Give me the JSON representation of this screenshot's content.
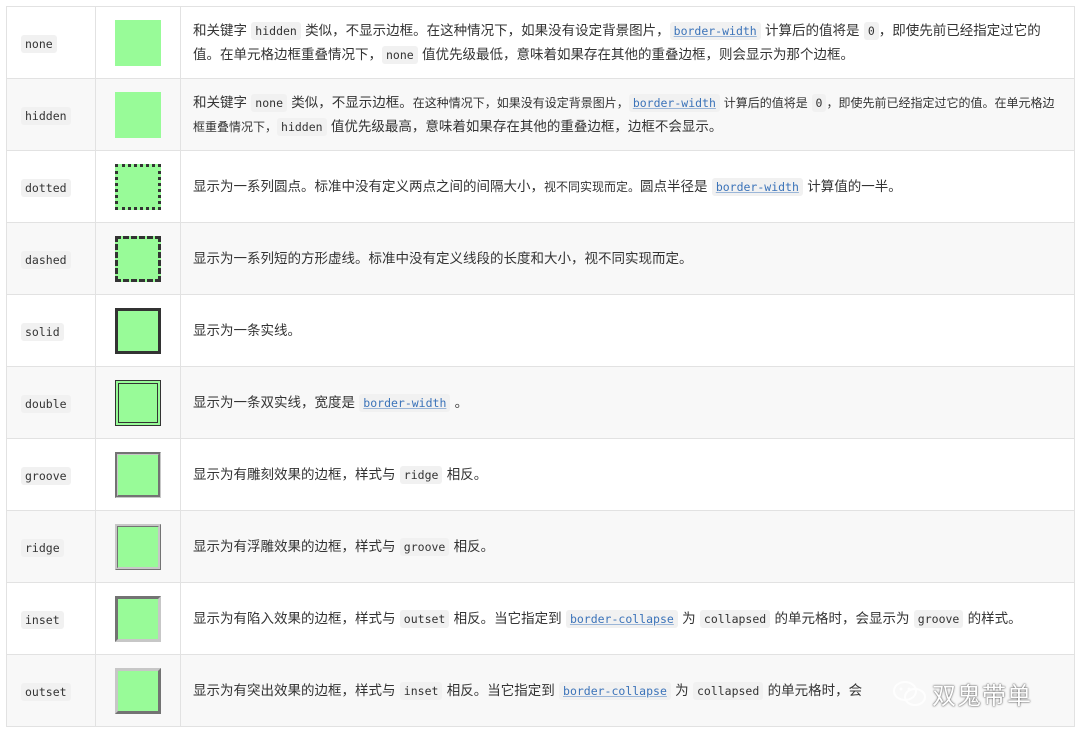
{
  "rows": [
    {
      "keyword": "none",
      "style": "none",
      "segments": [
        {
          "t": "text",
          "v": "和关键字 "
        },
        {
          "t": "code",
          "v": "hidden"
        },
        {
          "t": "text",
          "v": " 类似，不显示边框。在这种情况下，如果没有设定背景图片，"
        },
        {
          "t": "link",
          "v": "border-width"
        },
        {
          "t": "text",
          "v": " 计算后的值将是 "
        },
        {
          "t": "code",
          "v": "0"
        },
        {
          "t": "text",
          "v": "，即使先前已经指定过它的值。在单元格边框重叠情况下，"
        },
        {
          "t": "code",
          "v": "none"
        },
        {
          "t": "text",
          "v": " 值优先级最低，意味着如果存在其他的重叠边框，则会显示为那个边框。"
        }
      ]
    },
    {
      "keyword": "hidden",
      "style": "hidden",
      "segments": [
        {
          "t": "text",
          "v": "和关键字 "
        },
        {
          "t": "code",
          "v": "none"
        },
        {
          "t": "text",
          "v": " 类似，不显示边框。"
        },
        {
          "t": "small",
          "v": "在这种情况下，如果没有设定背景图片，"
        },
        {
          "t": "link",
          "v": "border-width"
        },
        {
          "t": "small",
          "v": " 计算后的值将是 "
        },
        {
          "t": "code",
          "v": "0"
        },
        {
          "t": "small",
          "v": "，即使先前已经指定过它的值。在单元格边框重叠情况下，"
        },
        {
          "t": "code",
          "v": "hidden"
        },
        {
          "t": "text",
          "v": " 值优先级最高，意味着如果存在其他的重叠边框，边框不会显示。"
        }
      ]
    },
    {
      "keyword": "dotted",
      "style": "dotted",
      "segments": [
        {
          "t": "text",
          "v": "显示为一系列圆点。标准中没有定义两点之间的间隔大小，"
        },
        {
          "t": "small",
          "v": "视不同实现而定。"
        },
        {
          "t": "text",
          "v": "圆点半径是 "
        },
        {
          "t": "link",
          "v": "border-width"
        },
        {
          "t": "text",
          "v": " 计算值的一半。"
        }
      ]
    },
    {
      "keyword": "dashed",
      "style": "dashed",
      "segments": [
        {
          "t": "text",
          "v": "显示为一系列短的方形虚线。标准中没有定义线段的长度和大小，视不同实现而定。"
        }
      ]
    },
    {
      "keyword": "solid",
      "style": "solid",
      "segments": [
        {
          "t": "text",
          "v": "显示为一条实线。"
        }
      ]
    },
    {
      "keyword": "double",
      "style": "double",
      "segments": [
        {
          "t": "text",
          "v": "显示为一条双实线，宽度是 "
        },
        {
          "t": "link",
          "v": "border-width"
        },
        {
          "t": "text",
          "v": " 。"
        }
      ]
    },
    {
      "keyword": "groove",
      "style": "groove",
      "segments": [
        {
          "t": "text",
          "v": "显示为有雕刻效果的边框，样式与 "
        },
        {
          "t": "code",
          "v": "ridge"
        },
        {
          "t": "text",
          "v": " 相反。"
        }
      ]
    },
    {
      "keyword": "ridge",
      "style": "ridge",
      "segments": [
        {
          "t": "text",
          "v": "显示为有浮雕效果的边框，样式与 "
        },
        {
          "t": "code",
          "v": "groove"
        },
        {
          "t": "text",
          "v": " 相反。"
        }
      ]
    },
    {
      "keyword": "inset",
      "style": "inset",
      "segments": [
        {
          "t": "text",
          "v": "显示为有陷入效果的边框，样式与 "
        },
        {
          "t": "code",
          "v": "outset"
        },
        {
          "t": "text",
          "v": " 相反。当它指定到 "
        },
        {
          "t": "link",
          "v": "border-collapse"
        },
        {
          "t": "text",
          "v": " 为 "
        },
        {
          "t": "code",
          "v": "collapsed"
        },
        {
          "t": "text",
          "v": " 的单元格时，会显示为 "
        },
        {
          "t": "code",
          "v": "groove"
        },
        {
          "t": "text",
          "v": " 的样式。"
        }
      ]
    },
    {
      "keyword": "outset",
      "style": "outset",
      "segments": [
        {
          "t": "text",
          "v": "显示为有突出效果的边框，样式与 "
        },
        {
          "t": "code",
          "v": "inset"
        },
        {
          "t": "text",
          "v": " 相反。当它指定到 "
        },
        {
          "t": "link",
          "v": "border-collapse"
        },
        {
          "t": "text",
          "v": " 为 "
        },
        {
          "t": "code",
          "v": "collapsed"
        },
        {
          "t": "text",
          "v": " 的单元格时，会"
        }
      ]
    }
  ],
  "watermark": {
    "text": "双鬼带单",
    "icon": "wechat-icon"
  },
  "colors": {
    "swatch_fill": "#98fb98",
    "link": "#3b73b9",
    "alt_row": "#f8f8f8",
    "grid": "#e2e2e2"
  }
}
